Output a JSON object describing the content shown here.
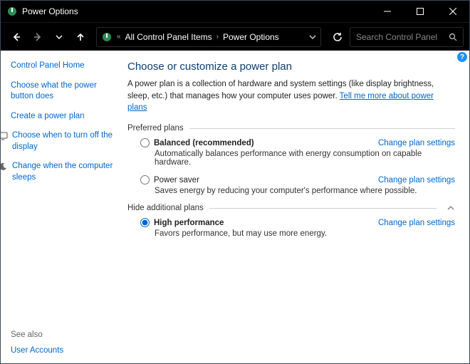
{
  "window": {
    "title": "Power Options"
  },
  "breadcrumb": {
    "item1": "All Control Panel Items",
    "item2": "Power Options"
  },
  "search": {
    "placeholder": "Search Control Panel"
  },
  "sidebar": {
    "home": "Control Panel Home",
    "link1": "Choose what the power button does",
    "link2": "Create a power plan",
    "link3": "Choose when to turn off the display",
    "link4": "Change when the computer sleeps",
    "seealso": "See also",
    "related1": "User Accounts"
  },
  "main": {
    "heading": "Choose or customize a power plan",
    "intro_a": "A power plan is a collection of hardware and system settings (like display brightness, sleep, etc.) that manages how your computer uses power. ",
    "intro_link": "Tell me more about power plans",
    "section_preferred": "Preferred plans",
    "section_additional": "Hide additional plans",
    "change_link": "Change plan settings",
    "plans": {
      "balanced": {
        "name": "Balanced (recommended)",
        "desc": "Automatically balances performance with energy consumption on capable hardware."
      },
      "saver": {
        "name": "Power saver",
        "desc": "Saves energy by reducing your computer's performance where possible."
      },
      "high": {
        "name": "High performance",
        "desc": "Favors performance, but may use more energy."
      }
    }
  }
}
